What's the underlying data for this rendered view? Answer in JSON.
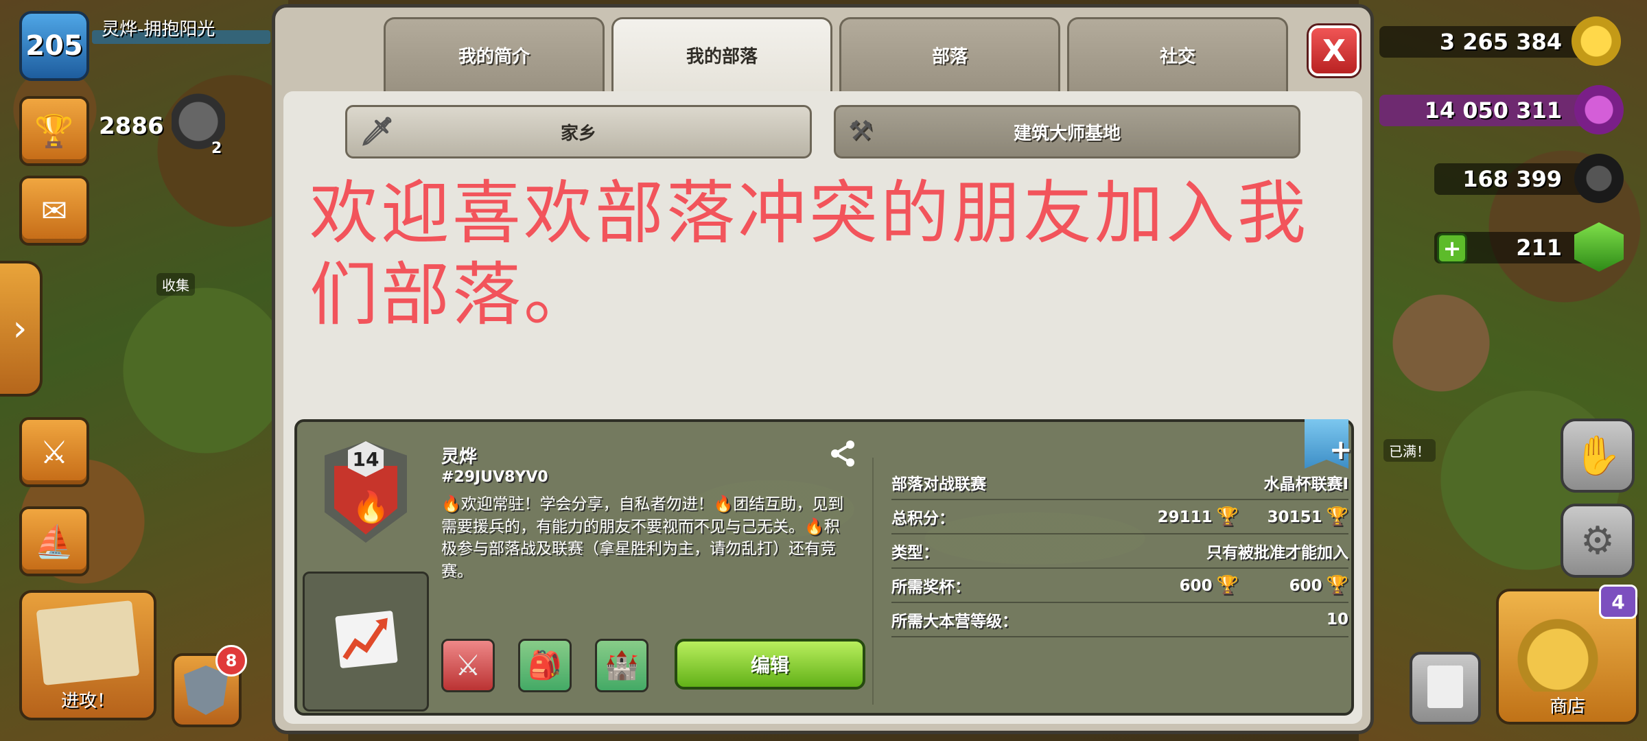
{
  "hud": {
    "player_level": "205",
    "player_name": "灵烨-拥抱阳光",
    "trophies": "2886",
    "league_rank": "2",
    "collect_label": "收集",
    "attack_label": "进攻！",
    "builder_notifications": "8",
    "gold": "3 265 384",
    "elixir": "14 050 311",
    "dark_elixir": "168 399",
    "gems": "211",
    "full_label": "已满！",
    "shop_label": "商店",
    "shop_badge": "4"
  },
  "panel": {
    "tabs": [
      "我的简介",
      "我的部落",
      "部落",
      "社交"
    ],
    "active_tab": 1,
    "close_label": "X",
    "subtabs": {
      "home": "家乡",
      "builder": "建筑大师基地"
    },
    "message": "欢迎喜欢部落冲突的朋友加入我们部落。"
  },
  "clan": {
    "level": "14",
    "name": "灵烨",
    "tag": "#29JUV8YV0",
    "description": "🔥欢迎常驻！学会分享，自私者勿进！🔥团结互助，见到需要援兵的，有能力的朋友不要视而不见与己无关。🔥积极参与部落战及联赛（拿星胜利为主，请勿乱打）还有竞赛。",
    "edit_label": "编辑",
    "info": {
      "war_league_label": "部落对战联赛",
      "war_league_value": "水晶杯联赛I",
      "total_points_label": "总积分：",
      "total_points_1": "29111",
      "total_points_2": "30151",
      "type_label": "类型：",
      "type_value": "只有被批准才能加入",
      "required_trophies_label": "所需奖杯：",
      "required_trophies_1": "600",
      "required_trophies_2": "600",
      "required_th_label": "所需大本营等级：",
      "required_th_value": "10"
    }
  },
  "colors": {
    "message_red": "#f2545b",
    "edit_green": "#7cc92c",
    "close_red": "#d93a3a"
  }
}
